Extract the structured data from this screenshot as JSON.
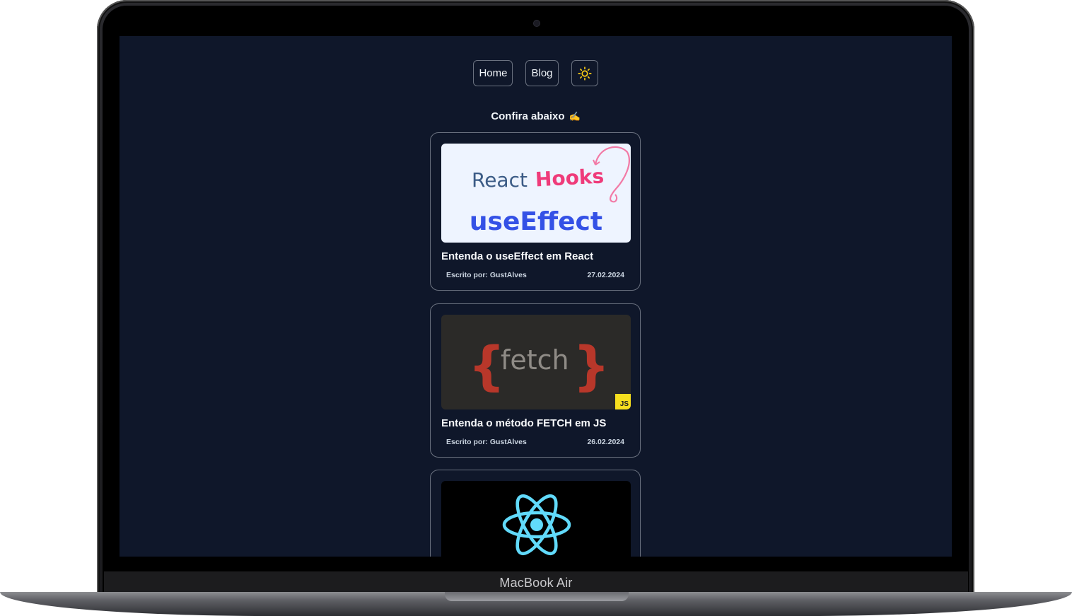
{
  "nav": {
    "home_label": "Home",
    "blog_label": "Blog",
    "theme_icon": "sun-icon"
  },
  "heading": {
    "text": "Confira abaixo",
    "emoji": "✍️"
  },
  "posts": [
    {
      "title": "Entenda o useEffect em React",
      "author": "Escrito por: GustAlves",
      "date": "27.02.2024",
      "thumb": {
        "line1a": "React",
        "line1b": "Hooks",
        "line2": "useEffect"
      }
    },
    {
      "title": "Entenda o método FETCH em JS",
      "author": "Escrito por: GustAlves",
      "date": "26.02.2024",
      "thumb": {
        "brace_open": "{",
        "word": "fetch",
        "brace_close": "}",
        "badge": "JS"
      }
    },
    {
      "thumb": {
        "icon": "react-logo-icon"
      }
    }
  ],
  "device": {
    "label": "MacBook Air"
  },
  "colors": {
    "page_bg": "#0f172a",
    "border": "#6b7280",
    "sun": "#facc15",
    "hooks_pink": "#ef3b7a",
    "useeffect_blue": "#3451e6",
    "fetch_red": "#b8372a",
    "react_cyan": "#61dafb"
  }
}
